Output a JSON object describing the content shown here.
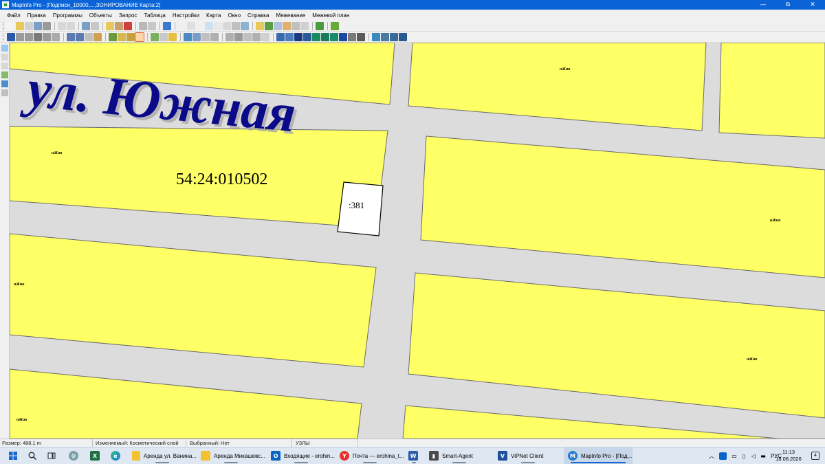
{
  "window": {
    "title": "MapInfo Pro - [Подписи_10000,...,ЗОНИРОВАНИЕ Карта:2]",
    "minimize_glyph": "—",
    "maximize_glyph": "⧉",
    "close_glyph": "✕"
  },
  "menu": [
    "Файл",
    "Правка",
    "Программы",
    "Объекты",
    "Запрос",
    "Таблица",
    "Настройки",
    "Карта",
    "Окно",
    "Справка",
    "Межевание",
    "Межевой план"
  ],
  "map": {
    "street_label": "ул. Южная",
    "block_label": "54:24:010502",
    "parcel_label": ":381",
    "zone_label": "нЖин",
    "colors": {
      "parcel_fill": "#ffff66",
      "road": "#dcdcdc",
      "street_text": "#0b0b8a",
      "outline": "#000000"
    }
  },
  "status": {
    "size": "Размер: 488,1 m",
    "editable": "Изменяемый: Косметический слой",
    "selected": "Выбранный: Нет",
    "nodes": "УЗЛЫ"
  },
  "taskbar": {
    "apps": [
      {
        "name": "start-button",
        "label": "",
        "icon": "windows-logo-icon"
      },
      {
        "name": "search-button",
        "label": "",
        "icon": "search-icon"
      },
      {
        "name": "task-view-button",
        "label": "",
        "icon": "task-view-icon"
      },
      {
        "name": "pinned-app",
        "label": "",
        "icon": "settings-icon"
      },
      {
        "name": "excel-app",
        "label": "",
        "icon": "excel-icon"
      },
      {
        "name": "edge-app",
        "label": "",
        "icon": "edge-icon"
      },
      {
        "name": "task-arenda-vanina",
        "label": "Аренда ул. Ванина...",
        "icon": "folder-icon"
      },
      {
        "name": "task-arenda-mikashev",
        "label": "Аренда Микашевс...",
        "icon": "folder-icon"
      },
      {
        "name": "task-outlook",
        "label": "Входящие - erohin...",
        "icon": "outlook-icon"
      },
      {
        "name": "task-yandex-mail",
        "label": "Почта — erohina_t...",
        "icon": "yandex-browser-icon"
      },
      {
        "name": "task-word",
        "label": "",
        "icon": "word-icon"
      },
      {
        "name": "task-smart-agent",
        "label": "Smart-Agent",
        "icon": "smart-agent-icon"
      },
      {
        "name": "task-vipnet",
        "label": "ViPNet Client",
        "icon": "vipnet-icon"
      },
      {
        "name": "task-mapinfo",
        "label": "MapInfo Pro - [Под...",
        "icon": "mapinfo-icon"
      }
    ],
    "tray": {
      "language": "РУС",
      "time": "11:13",
      "date": "18.08.2026",
      "notifications": "4"
    }
  }
}
